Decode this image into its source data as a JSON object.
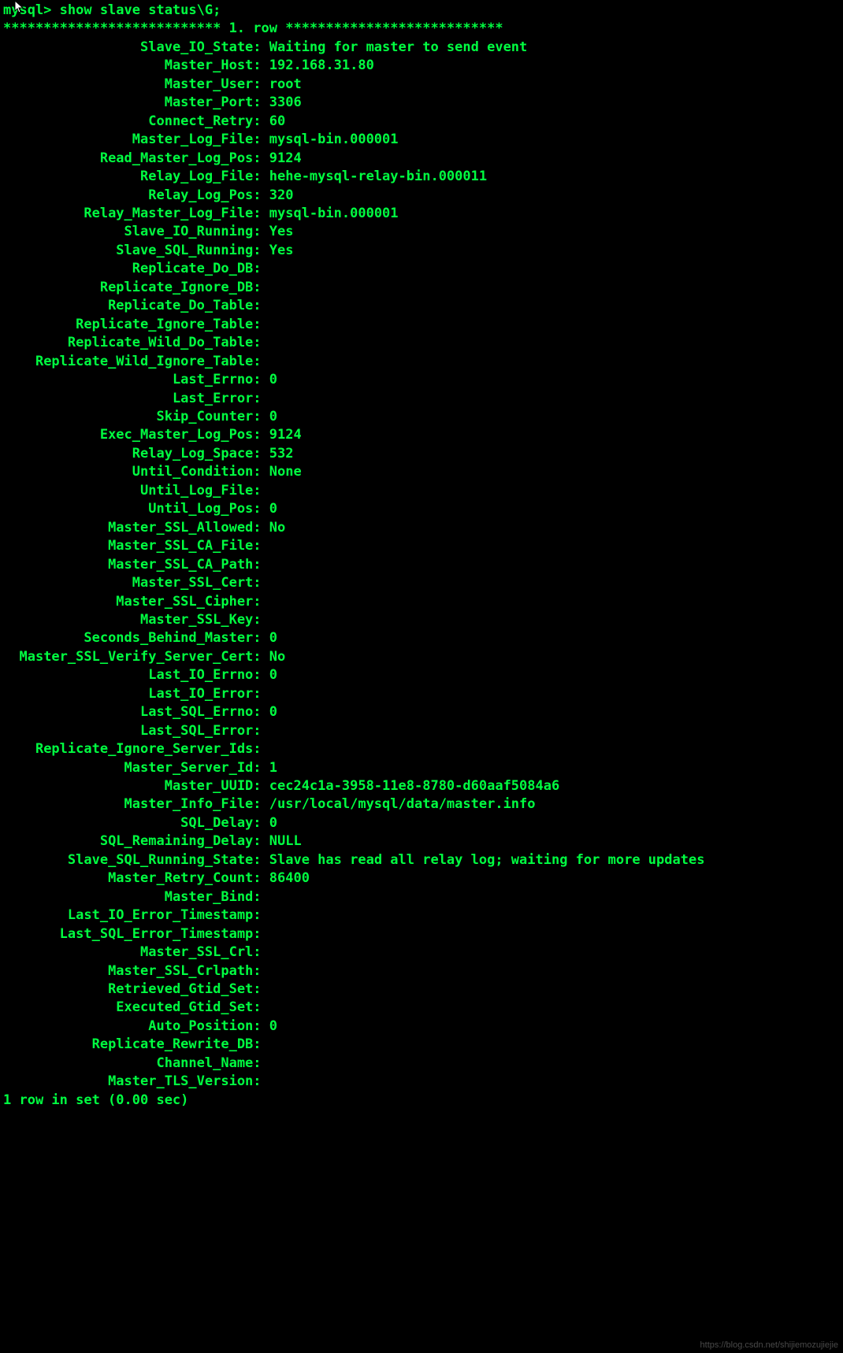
{
  "prompt_prefix": "my",
  "prompt_suffix": "sql> ",
  "command": "show slave status\\G;",
  "row_header": "*************************** 1. row ***************************",
  "label_width": 31,
  "fields": [
    {
      "label": "Slave_IO_State",
      "value": "Waiting for master to send event"
    },
    {
      "label": "Master_Host",
      "value": "192.168.31.80"
    },
    {
      "label": "Master_User",
      "value": "root"
    },
    {
      "label": "Master_Port",
      "value": "3306"
    },
    {
      "label": "Connect_Retry",
      "value": "60"
    },
    {
      "label": "Master_Log_File",
      "value": "mysql-bin.000001"
    },
    {
      "label": "Read_Master_Log_Pos",
      "value": "9124"
    },
    {
      "label": "Relay_Log_File",
      "value": "hehe-mysql-relay-bin.000011"
    },
    {
      "label": "Relay_Log_Pos",
      "value": "320"
    },
    {
      "label": "Relay_Master_Log_File",
      "value": "mysql-bin.000001"
    },
    {
      "label": "Slave_IO_Running",
      "value": "Yes"
    },
    {
      "label": "Slave_SQL_Running",
      "value": "Yes"
    },
    {
      "label": "Replicate_Do_DB",
      "value": ""
    },
    {
      "label": "Replicate_Ignore_DB",
      "value": ""
    },
    {
      "label": "Replicate_Do_Table",
      "value": ""
    },
    {
      "label": "Replicate_Ignore_Table",
      "value": ""
    },
    {
      "label": "Replicate_Wild_Do_Table",
      "value": ""
    },
    {
      "label": "Replicate_Wild_Ignore_Table",
      "value": ""
    },
    {
      "label": "Last_Errno",
      "value": "0"
    },
    {
      "label": "Last_Error",
      "value": ""
    },
    {
      "label": "Skip_Counter",
      "value": "0"
    },
    {
      "label": "Exec_Master_Log_Pos",
      "value": "9124"
    },
    {
      "label": "Relay_Log_Space",
      "value": "532"
    },
    {
      "label": "Until_Condition",
      "value": "None"
    },
    {
      "label": "Until_Log_File",
      "value": ""
    },
    {
      "label": "Until_Log_Pos",
      "value": "0"
    },
    {
      "label": "Master_SSL_Allowed",
      "value": "No"
    },
    {
      "label": "Master_SSL_CA_File",
      "value": ""
    },
    {
      "label": "Master_SSL_CA_Path",
      "value": ""
    },
    {
      "label": "Master_SSL_Cert",
      "value": ""
    },
    {
      "label": "Master_SSL_Cipher",
      "value": ""
    },
    {
      "label": "Master_SSL_Key",
      "value": ""
    },
    {
      "label": "Seconds_Behind_Master",
      "value": "0"
    },
    {
      "label": "Master_SSL_Verify_Server_Cert",
      "value": "No"
    },
    {
      "label": "Last_IO_Errno",
      "value": "0"
    },
    {
      "label": "Last_IO_Error",
      "value": ""
    },
    {
      "label": "Last_SQL_Errno",
      "value": "0"
    },
    {
      "label": "Last_SQL_Error",
      "value": ""
    },
    {
      "label": "Replicate_Ignore_Server_Ids",
      "value": ""
    },
    {
      "label": "Master_Server_Id",
      "value": "1"
    },
    {
      "label": "Master_UUID",
      "value": "cec24c1a-3958-11e8-8780-d60aaf5084a6"
    },
    {
      "label": "Master_Info_File",
      "value": "/usr/local/mysql/data/master.info"
    },
    {
      "label": "SQL_Delay",
      "value": "0"
    },
    {
      "label": "SQL_Remaining_Delay",
      "value": "NULL"
    },
    {
      "label": "Slave_SQL_Running_State",
      "value": "Slave has read all relay log; waiting for more updates"
    },
    {
      "label": "Master_Retry_Count",
      "value": "86400"
    },
    {
      "label": "Master_Bind",
      "value": ""
    },
    {
      "label": "Last_IO_Error_Timestamp",
      "value": ""
    },
    {
      "label": "Last_SQL_Error_Timestamp",
      "value": ""
    },
    {
      "label": "Master_SSL_Crl",
      "value": ""
    },
    {
      "label": "Master_SSL_Crlpath",
      "value": ""
    },
    {
      "label": "Retrieved_Gtid_Set",
      "value": ""
    },
    {
      "label": "Executed_Gtid_Set",
      "value": ""
    },
    {
      "label": "Auto_Position",
      "value": "0"
    },
    {
      "label": "Replicate_Rewrite_DB",
      "value": ""
    },
    {
      "label": "Channel_Name",
      "value": ""
    },
    {
      "label": "Master_TLS_Version",
      "value": ""
    }
  ],
  "footer": "1 row in set (0.00 sec)",
  "watermark": "https://blog.csdn.net/shijiemozujiejie"
}
